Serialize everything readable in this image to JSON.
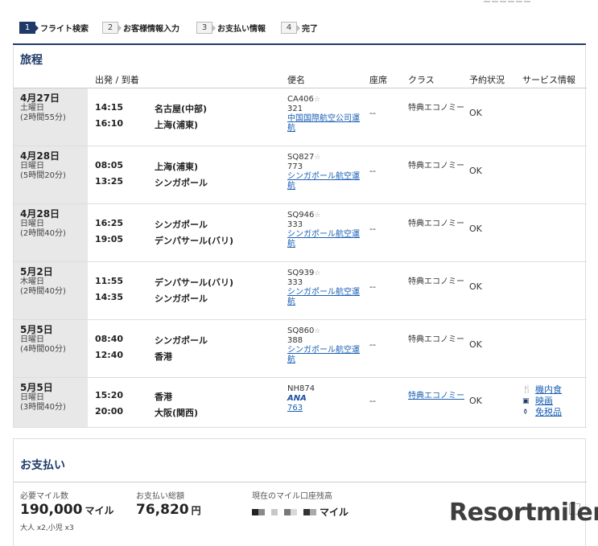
{
  "top_text": "ーーーーーー",
  "steps": [
    {
      "num": "1",
      "label": "フライト検索"
    },
    {
      "num": "2",
      "label": "お客様情報入力"
    },
    {
      "num": "3",
      "label": "お支払い情報"
    },
    {
      "num": "4",
      "label": "完了"
    }
  ],
  "itinerary": {
    "title": "旅程",
    "headers": {
      "route": "出発 / 到着",
      "flight": "便名",
      "seat": "座席",
      "class": "クラス",
      "status": "予約状況",
      "service": "サービス情報"
    },
    "rows": [
      {
        "date": "4月27日",
        "weekday": "土曜日",
        "duration": "(2時間55分)",
        "dep_time": "14:15",
        "dep_airport": "名古屋(中部)",
        "arr_time": "16:10",
        "arr_airport": "上海(浦東)",
        "flight_no": "CA406",
        "aircraft": "321",
        "carrier": "中国国際航空公司運航",
        "seat": "--",
        "class": "特典エコノミー",
        "status": "OK"
      },
      {
        "date": "4月28日",
        "weekday": "日曜日",
        "duration": "(5時間20分)",
        "dep_time": "08:05",
        "dep_airport": "上海(浦東)",
        "arr_time": "13:25",
        "arr_airport": "シンガポール",
        "flight_no": "SQ827",
        "aircraft": "773",
        "carrier": "シンガポール航空運航",
        "seat": "--",
        "class": "特典エコノミー",
        "status": "OK"
      },
      {
        "date": "4月28日",
        "weekday": "日曜日",
        "duration": "(2時間40分)",
        "dep_time": "16:25",
        "dep_airport": "シンガポール",
        "arr_time": "19:05",
        "arr_airport": "デンパサール(バリ)",
        "flight_no": "SQ946",
        "aircraft": "333",
        "carrier": "シンガポール航空運航",
        "seat": "--",
        "class": "特典エコノミー",
        "status": "OK"
      },
      {
        "date": "5月2日",
        "weekday": "木曜日",
        "duration": "(2時間40分)",
        "dep_time": "11:55",
        "dep_airport": "デンパサール(バリ)",
        "arr_time": "14:35",
        "arr_airport": "シンガポール",
        "flight_no": "SQ939",
        "aircraft": "333",
        "carrier": "シンガポール航空運航",
        "seat": "--",
        "class": "特典エコノミー",
        "status": "OK"
      },
      {
        "date": "5月5日",
        "weekday": "日曜日",
        "duration": "(4時間00分)",
        "dep_time": "08:40",
        "dep_airport": "シンガポール",
        "arr_time": "12:40",
        "arr_airport": "香港",
        "flight_no": "SQ860",
        "aircraft": "388",
        "carrier": "シンガポール航空運航",
        "seat": "--",
        "class": "特典エコノミー",
        "status": "OK"
      },
      {
        "date": "5月5日",
        "weekday": "日曜日",
        "duration": "(3時間40分)",
        "dep_time": "15:20",
        "dep_airport": "香港",
        "arr_time": "20:00",
        "arr_airport": "大阪(関西)",
        "flight_no": "NH874",
        "ana_logo": "ANA",
        "aircraft": "763",
        "seat": "--",
        "class": "特典エコノミー",
        "status": "OK"
      }
    ],
    "services": [
      "機内食",
      "映画",
      "免税品"
    ]
  },
  "payment": {
    "title": "お支払い",
    "miles_label": "必要マイル数",
    "miles_value": "190,000",
    "miles_unit": "マイル",
    "pax": "大人 x2,小児 x3",
    "total_label": "お支払い総額",
    "total_value": "76,820",
    "total_unit": "円",
    "balance_label": "現在のマイル口座残高",
    "balance_unit": "マイル"
  },
  "watermark": "Resortmiler"
}
